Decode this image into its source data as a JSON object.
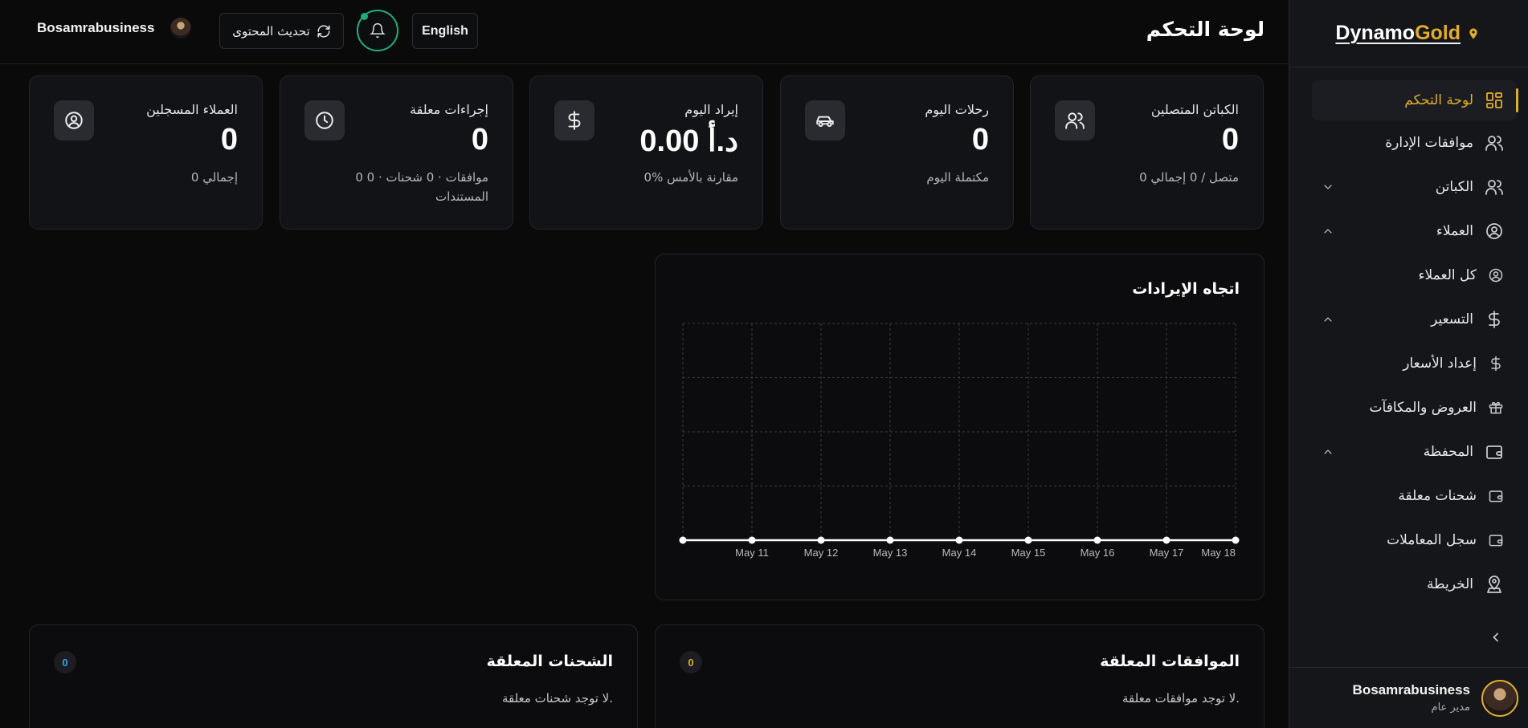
{
  "brand": {
    "part1": "Dynamo",
    "part2": "Gold"
  },
  "header": {
    "title": "لوحة التحكم",
    "username": "Bosamrabusiness",
    "refresh_label": "تحديث المحتوى",
    "lang_label": "English"
  },
  "sidebar": {
    "items": [
      {
        "label": "لوحة التحكم",
        "icon": "dashboard-grid-icon"
      },
      {
        "label": "موافقات الإدارة",
        "icon": "users-icon"
      },
      {
        "label": "الكباتن",
        "icon": "users-icon"
      },
      {
        "label": "العملاء",
        "icon": "user-circle-icon"
      },
      {
        "label": "كل العملاء",
        "icon": "user-circle-icon"
      },
      {
        "label": "التسعير",
        "icon": "dollar-icon"
      },
      {
        "label": "إعداد الأسعار",
        "icon": "dollar-icon"
      },
      {
        "label": "العروض والمكافآت",
        "icon": "gift-icon"
      },
      {
        "label": "المحفظة",
        "icon": "wallet-icon"
      },
      {
        "label": "شحنات معلقة",
        "icon": "wallet-icon"
      },
      {
        "label": "سجل المعاملات",
        "icon": "wallet-icon"
      },
      {
        "label": "الخريطة",
        "icon": "map-pin-icon"
      }
    ],
    "user": {
      "name": "Bosamrabusiness",
      "role": "مدير عام"
    }
  },
  "stats": [
    {
      "title": "الكباتن المتصلين",
      "value": "0",
      "sub": "0 متصل / 0 إجمالي",
      "icon": "users-icon"
    },
    {
      "title": "رحلات اليوم",
      "value": "0",
      "sub": "مكتملة اليوم",
      "icon": "car-icon"
    },
    {
      "title": "إيراد اليوم",
      "value": "د.أ 0.00",
      "sub": "0% مقارنة بالأمس",
      "icon": "dollar-icon"
    },
    {
      "title": "إجراءات معلقة",
      "value": "0",
      "sub": "0 موافقات · 0 شحنات · 0 المستندات",
      "icon": "clock-icon"
    },
    {
      "title": "العملاء المسجلين",
      "value": "0",
      "sub": "0 إجمالي",
      "icon": "user-circle-icon"
    }
  ],
  "chart_data": {
    "type": "line",
    "title": "اتجاه الإيرادات",
    "x": [
      "",
      "May 11",
      "May 12",
      "May 13",
      "May 14",
      "May 15",
      "May 16",
      "May 17",
      "May 18"
    ],
    "series": [
      {
        "values": [
          0,
          0,
          0,
          0,
          0,
          0,
          0,
          0,
          0
        ]
      }
    ],
    "grid": true,
    "line_color": "#ffffff"
  },
  "panels": {
    "approvals": {
      "title": "الموافقات المعلقة",
      "count": "0",
      "empty": "لا توجد موافقات معلقة.",
      "badge_color": "#e0ac2a"
    },
    "topups": {
      "title": "الشحنات المعلقة",
      "count": "0",
      "empty": "لا توجد شحنات معلقة.",
      "badge_color": "#3b9fe0"
    }
  }
}
